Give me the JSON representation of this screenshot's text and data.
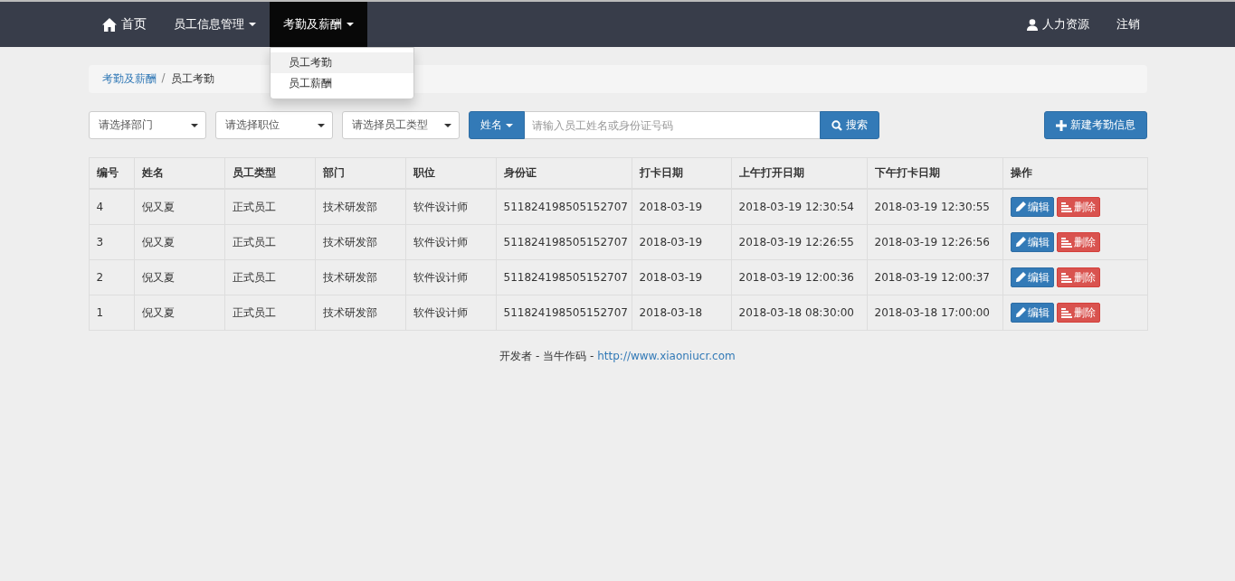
{
  "navbar": {
    "items": [
      {
        "label": "首页",
        "kind": "home",
        "selected": false
      },
      {
        "label": "员工信息管理",
        "kind": "dropdown",
        "selected": false
      },
      {
        "label": "考勤及薪酬",
        "kind": "dropdown",
        "selected": true
      }
    ],
    "right_items": [
      {
        "label": "人力资源",
        "kind": "user"
      },
      {
        "label": "注销",
        "kind": "plain"
      }
    ],
    "dropdown_menu": [
      {
        "label": "员工考勤",
        "selected": true
      },
      {
        "label": "员工薪酬",
        "selected": false
      }
    ]
  },
  "breadcrumb": {
    "separator": "/",
    "items": [
      {
        "label": "考勤及薪酬",
        "kind": "link"
      },
      {
        "label": "员工考勤",
        "kind": "current"
      }
    ]
  },
  "filters": [
    {
      "placeholder": "请选择部门"
    },
    {
      "placeholder": "请选择职位"
    },
    {
      "placeholder": "请选择员工类型"
    }
  ],
  "search": {
    "field_button": "姓名",
    "placeholder": "请输入员工姓名或身份证号码",
    "button": "搜索"
  },
  "new_button": "新建考勤信息",
  "table": {
    "columns": [
      "编号",
      "姓名",
      "员工类型",
      "部门",
      "职位",
      "身份证",
      "打卡日期",
      "上午打开日期",
      "下午打卡日期",
      "操作"
    ],
    "rows": [
      {
        "cells": [
          "4",
          "倪又夏",
          "正式员工",
          "技术研发部",
          "软件设计师",
          "511824198505152707",
          "2018-03-19",
          "2018-03-19 12:30:54",
          "2018-03-19 12:30:55"
        ],
        "edit": "编辑",
        "delete": "删除"
      },
      {
        "cells": [
          "3",
          "倪又夏",
          "正式员工",
          "技术研发部",
          "软件设计师",
          "511824198505152707",
          "2018-03-19",
          "2018-03-19 12:26:55",
          "2018-03-19 12:26:56"
        ],
        "edit": "编辑",
        "delete": "删除"
      },
      {
        "cells": [
          "2",
          "倪又夏",
          "正式员工",
          "技术研发部",
          "软件设计师",
          "511824198505152707",
          "2018-03-19",
          "2018-03-19 12:00:36",
          "2018-03-19 12:00:37"
        ],
        "edit": "编辑",
        "delete": "删除"
      },
      {
        "cells": [
          "1",
          "倪又夏",
          "正式员工",
          "技术研发部",
          "软件设计师",
          "511824198505152707",
          "2018-03-18",
          "2018-03-18 08:30:00",
          "2018-03-18 17:00:00"
        ],
        "edit": "编辑",
        "delete": "删除"
      }
    ]
  },
  "footer": {
    "text": "开发者 - 当牛作码 - ",
    "link": "http://www.xiaoniucr.com"
  }
}
